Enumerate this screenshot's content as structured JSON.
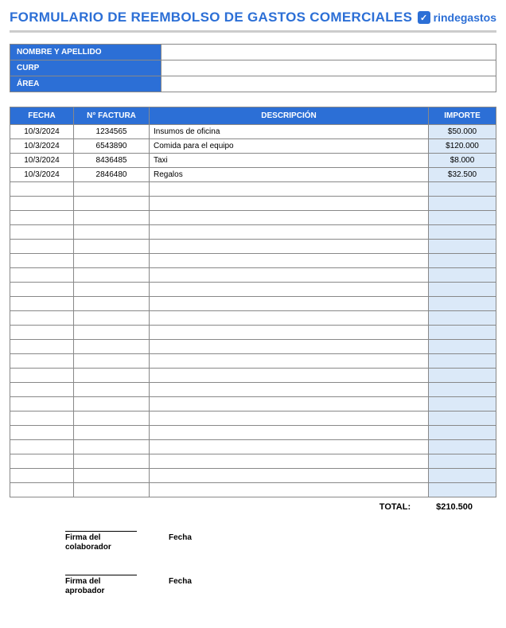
{
  "title": "FORMULARIO DE REEMBOLSO DE GASTOS COMERCIALES",
  "brand": {
    "icon_glyph": "✓",
    "name": "rindegastos"
  },
  "info": {
    "name_label": "NOMBRE Y APELLIDO",
    "curp_label": "CURP",
    "area_label": "ÁREA",
    "name_value": "",
    "curp_value": "",
    "area_value": ""
  },
  "columns": {
    "fecha": "FECHA",
    "factura": "N° FACTURA",
    "descripcion": "DESCRIPCIÓN",
    "importe": "IMPORTE"
  },
  "rows": [
    {
      "fecha": "10/3/2024",
      "factura": "1234565",
      "descripcion": "Insumos de oficina",
      "importe": "$50.000"
    },
    {
      "fecha": "10/3/2024",
      "factura": "6543890",
      "descripcion": "Comida para el equipo",
      "importe": "$120.000"
    },
    {
      "fecha": "10/3/2024",
      "factura": "8436485",
      "descripcion": "Taxi",
      "importe": "$8.000"
    },
    {
      "fecha": "10/3/2024",
      "factura": "2846480",
      "descripcion": "Regalos",
      "importe": "$32.500"
    }
  ],
  "empty_rows": 22,
  "total": {
    "label": "TOTAL:",
    "value": "$210.500"
  },
  "signatures": {
    "colab": "Firma del colaborador",
    "aprob": "Firma del aprobador",
    "fecha": "Fecha"
  }
}
